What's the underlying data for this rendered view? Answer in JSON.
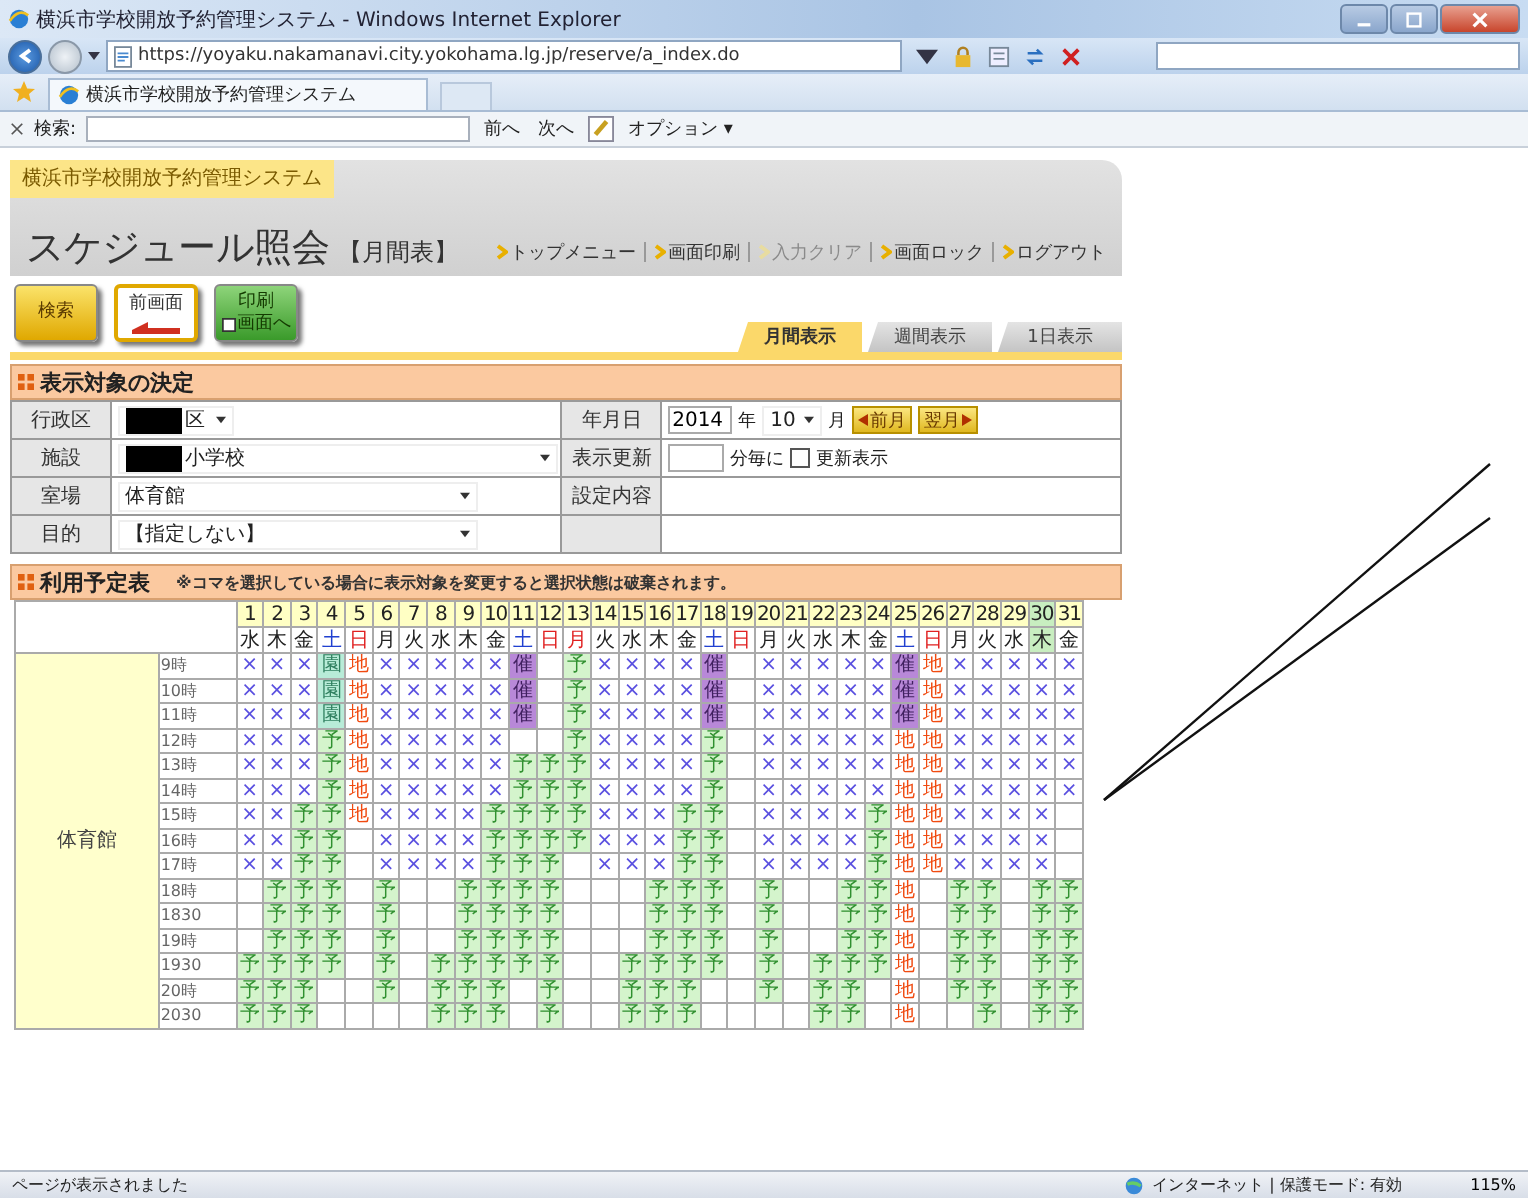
{
  "browser": {
    "title": "横浜市学校開放予約管理システム - Windows Internet Explorer",
    "url": "https://yoyaku.nakamanavi.city.yokohama.lg.jp/reserve/a_index.do",
    "tab": "横浜市学校開放予約管理システム",
    "search_label": "検索:",
    "find_prev": "前へ",
    "find_next": "次へ",
    "options": "オプション ▾"
  },
  "header": {
    "system_name": "横浜市学校開放予約管理システム",
    "page_title": "スケジュール照会",
    "page_subtitle": "【月間表】",
    "links": [
      {
        "label": "トップメニュー",
        "disabled": false
      },
      {
        "label": "画面印刷",
        "disabled": false
      },
      {
        "label": "入力クリア",
        "disabled": true
      },
      {
        "label": "画面ロック",
        "disabled": false
      },
      {
        "label": "ログアウト",
        "disabled": false
      }
    ]
  },
  "buttons": [
    {
      "kind": "search",
      "lines": [
        "検索"
      ]
    },
    {
      "kind": "back",
      "lines": [
        "前画面"
      ]
    },
    {
      "kind": "print",
      "lines": [
        "印刷",
        "画面へ"
      ]
    }
  ],
  "view_tabs": [
    {
      "label": "月間表示",
      "selected": true
    },
    {
      "label": "週間表示",
      "selected": false
    },
    {
      "label": "1日表示",
      "selected": false
    }
  ],
  "target": {
    "title": "表示対象の決定",
    "fields": [
      {
        "label": "行政区",
        "value": "区",
        "redacted": true
      },
      {
        "label": "施設",
        "value": "小学校",
        "redacted": true
      },
      {
        "label": "室場",
        "value": "体育館",
        "redacted": false
      },
      {
        "label": "目的",
        "value": "【指定しない】",
        "redacted": false
      }
    ],
    "date": {
      "label": "年月日",
      "year": "2014",
      "year_unit": "年",
      "month": "10",
      "month_unit": "月",
      "prev": "前月",
      "next": "翌月"
    },
    "refresh": {
      "label": "表示更新",
      "unit": "分毎に",
      "checkbox_label": "更新表示",
      "checked": false
    },
    "settings": {
      "label": "設定内容"
    }
  },
  "schedule": {
    "title": "利用予定表",
    "note": "※コマを選択している場合に表示対象を変更すると選択状態は破棄されます。",
    "facility": "体育館",
    "days": [
      {
        "date": "1",
        "weekday": "水",
        "kind": "weekday"
      },
      {
        "date": "2",
        "weekday": "木",
        "kind": "weekday"
      },
      {
        "date": "3",
        "weekday": "金",
        "kind": "weekday"
      },
      {
        "date": "4",
        "weekday": "土",
        "kind": "saturday"
      },
      {
        "date": "5",
        "weekday": "日",
        "kind": "holiday"
      },
      {
        "date": "6",
        "weekday": "月",
        "kind": "weekday"
      },
      {
        "date": "7",
        "weekday": "火",
        "kind": "weekday"
      },
      {
        "date": "8",
        "weekday": "水",
        "kind": "weekday"
      },
      {
        "date": "9",
        "weekday": "木",
        "kind": "weekday"
      },
      {
        "date": "10",
        "weekday": "金",
        "kind": "weekday"
      },
      {
        "date": "11",
        "weekday": "土",
        "kind": "saturday"
      },
      {
        "date": "12",
        "weekday": "日",
        "kind": "holiday"
      },
      {
        "date": "13",
        "weekday": "月",
        "kind": "holiday"
      },
      {
        "date": "14",
        "weekday": "火",
        "kind": "weekday"
      },
      {
        "date": "15",
        "weekday": "水",
        "kind": "weekday"
      },
      {
        "date": "16",
        "weekday": "木",
        "kind": "weekday"
      },
      {
        "date": "17",
        "weekday": "金",
        "kind": "weekday"
      },
      {
        "date": "18",
        "weekday": "土",
        "kind": "saturday"
      },
      {
        "date": "19",
        "weekday": "日",
        "kind": "holiday"
      },
      {
        "date": "20",
        "weekday": "月",
        "kind": "weekday"
      },
      {
        "date": "21",
        "weekday": "火",
        "kind": "weekday"
      },
      {
        "date": "22",
        "weekday": "水",
        "kind": "weekday"
      },
      {
        "date": "23",
        "weekday": "木",
        "kind": "weekday"
      },
      {
        "date": "24",
        "weekday": "金",
        "kind": "weekday"
      },
      {
        "date": "25",
        "weekday": "土",
        "kind": "saturday"
      },
      {
        "date": "26",
        "weekday": "日",
        "kind": "holiday"
      },
      {
        "date": "27",
        "weekday": "月",
        "kind": "weekday"
      },
      {
        "date": "28",
        "weekday": "火",
        "kind": "weekday"
      },
      {
        "date": "29",
        "weekday": "水",
        "kind": "weekday"
      },
      {
        "date": "30",
        "weekday": "木",
        "kind": "today"
      },
      {
        "date": "31",
        "weekday": "金",
        "kind": "weekday"
      }
    ],
    "rows": [
      {
        "time": "9時",
        "cells": [
          {
            "text": "×",
            "kind": "unavailable"
          },
          {
            "text": "×",
            "kind": "unavailable"
          },
          {
            "text": "×",
            "kind": "unavailable"
          },
          {
            "text": "園",
            "kind": "group"
          },
          {
            "text": "地",
            "kind": "local"
          },
          {
            "text": "×",
            "kind": "unavailable"
          },
          {
            "text": "×",
            "kind": "unavailable"
          },
          {
            "text": "×",
            "kind": "unavailable"
          },
          {
            "text": "×",
            "kind": "unavailable"
          },
          {
            "text": "×",
            "kind": "unavailable"
          },
          {
            "text": "催",
            "kind": "event"
          },
          null,
          {
            "text": "予",
            "kind": "reserved"
          },
          {
            "text": "×",
            "kind": "unavailable"
          },
          {
            "text": "×",
            "kind": "unavailable"
          },
          {
            "text": "×",
            "kind": "unavailable"
          },
          {
            "text": "×",
            "kind": "unavailable"
          },
          {
            "text": "催",
            "kind": "event"
          },
          null,
          {
            "text": "×",
            "kind": "unavailable"
          },
          {
            "text": "×",
            "kind": "unavailable"
          },
          {
            "text": "×",
            "kind": "unavailable"
          },
          {
            "text": "×",
            "kind": "unavailable"
          },
          {
            "text": "×",
            "kind": "unavailable"
          },
          {
            "text": "催",
            "kind": "event"
          },
          {
            "text": "地",
            "kind": "local"
          },
          {
            "text": "×",
            "kind": "unavailable"
          },
          {
            "text": "×",
            "kind": "unavailable"
          },
          {
            "text": "×",
            "kind": "unavailable"
          },
          {
            "text": "×",
            "kind": "unavailable"
          },
          {
            "text": "×",
            "kind": "unavailable"
          }
        ]
      },
      {
        "time": "10時",
        "cells": [
          {
            "text": "×",
            "kind": "unavailable"
          },
          {
            "text": "×",
            "kind": "unavailable"
          },
          {
            "text": "×",
            "kind": "unavailable"
          },
          {
            "text": "園",
            "kind": "group"
          },
          {
            "text": "地",
            "kind": "local"
          },
          {
            "text": "×",
            "kind": "unavailable"
          },
          {
            "text": "×",
            "kind": "unavailable"
          },
          {
            "text": "×",
            "kind": "unavailable"
          },
          {
            "text": "×",
            "kind": "unavailable"
          },
          {
            "text": "×",
            "kind": "unavailable"
          },
          {
            "text": "催",
            "kind": "event"
          },
          null,
          {
            "text": "予",
            "kind": "reserved"
          },
          {
            "text": "×",
            "kind": "unavailable"
          },
          {
            "text": "×",
            "kind": "unavailable"
          },
          {
            "text": "×",
            "kind": "unavailable"
          },
          {
            "text": "×",
            "kind": "unavailable"
          },
          {
            "text": "催",
            "kind": "event"
          },
          null,
          {
            "text": "×",
            "kind": "unavailable"
          },
          {
            "text": "×",
            "kind": "unavailable"
          },
          {
            "text": "×",
            "kind": "unavailable"
          },
          {
            "text": "×",
            "kind": "unavailable"
          },
          {
            "text": "×",
            "kind": "unavailable"
          },
          {
            "text": "催",
            "kind": "event"
          },
          {
            "text": "地",
            "kind": "local"
          },
          {
            "text": "×",
            "kind": "unavailable"
          },
          {
            "text": "×",
            "kind": "unavailable"
          },
          {
            "text": "×",
            "kind": "unavailable"
          },
          {
            "text": "×",
            "kind": "unavailable"
          },
          {
            "text": "×",
            "kind": "unavailable"
          }
        ]
      },
      {
        "time": "11時",
        "cells": [
          {
            "text": "×",
            "kind": "unavailable"
          },
          {
            "text": "×",
            "kind": "unavailable"
          },
          {
            "text": "×",
            "kind": "unavailable"
          },
          {
            "text": "園",
            "kind": "group"
          },
          {
            "text": "地",
            "kind": "local"
          },
          {
            "text": "×",
            "kind": "unavailable"
          },
          {
            "text": "×",
            "kind": "unavailable"
          },
          {
            "text": "×",
            "kind": "unavailable"
          },
          {
            "text": "×",
            "kind": "unavailable"
          },
          {
            "text": "×",
            "kind": "unavailable"
          },
          {
            "text": "催",
            "kind": "event"
          },
          null,
          {
            "text": "予",
            "kind": "reserved"
          },
          {
            "text": "×",
            "kind": "unavailable"
          },
          {
            "text": "×",
            "kind": "unavailable"
          },
          {
            "text": "×",
            "kind": "unavailable"
          },
          {
            "text": "×",
            "kind": "unavailable"
          },
          {
            "text": "催",
            "kind": "event"
          },
          null,
          {
            "text": "×",
            "kind": "unavailable"
          },
          {
            "text": "×",
            "kind": "unavailable"
          },
          {
            "text": "×",
            "kind": "unavailable"
          },
          {
            "text": "×",
            "kind": "unavailable"
          },
          {
            "text": "×",
            "kind": "unavailable"
          },
          {
            "text": "催",
            "kind": "event"
          },
          {
            "text": "地",
            "kind": "local"
          },
          {
            "text": "×",
            "kind": "unavailable"
          },
          {
            "text": "×",
            "kind": "unavailable"
          },
          {
            "text": "×",
            "kind": "unavailable"
          },
          {
            "text": "×",
            "kind": "unavailable"
          },
          {
            "text": "×",
            "kind": "unavailable"
          }
        ]
      },
      {
        "time": "12時",
        "cells": [
          {
            "text": "×",
            "kind": "unavailable"
          },
          {
            "text": "×",
            "kind": "unavailable"
          },
          {
            "text": "×",
            "kind": "unavailable"
          },
          {
            "text": "予",
            "kind": "reserved"
          },
          {
            "text": "地",
            "kind": "local"
          },
          {
            "text": "×",
            "kind": "unavailable"
          },
          {
            "text": "×",
            "kind": "unavailable"
          },
          {
            "text": "×",
            "kind": "unavailable"
          },
          {
            "text": "×",
            "kind": "unavailable"
          },
          {
            "text": "×",
            "kind": "unavailable"
          },
          null,
          null,
          {
            "text": "予",
            "kind": "reserved"
          },
          {
            "text": "×",
            "kind": "unavailable"
          },
          {
            "text": "×",
            "kind": "unavailable"
          },
          {
            "text": "×",
            "kind": "unavailable"
          },
          {
            "text": "×",
            "kind": "unavailable"
          },
          {
            "text": "予",
            "kind": "reserved"
          },
          null,
          {
            "text": "×",
            "kind": "unavailable"
          },
          {
            "text": "×",
            "kind": "unavailable"
          },
          {
            "text": "×",
            "kind": "unavailable"
          },
          {
            "text": "×",
            "kind": "unavailable"
          },
          {
            "text": "×",
            "kind": "unavailable"
          },
          {
            "text": "地",
            "kind": "local"
          },
          {
            "text": "地",
            "kind": "local"
          },
          {
            "text": "×",
            "kind": "unavailable"
          },
          {
            "text": "×",
            "kind": "unavailable"
          },
          {
            "text": "×",
            "kind": "unavailable"
          },
          {
            "text": "×",
            "kind": "unavailable"
          },
          {
            "text": "×",
            "kind": "unavailable"
          }
        ]
      },
      {
        "time": "13時",
        "cells": [
          {
            "text": "×",
            "kind": "unavailable"
          },
          {
            "text": "×",
            "kind": "unavailable"
          },
          {
            "text": "×",
            "kind": "unavailable"
          },
          {
            "text": "予",
            "kind": "reserved"
          },
          {
            "text": "地",
            "kind": "local"
          },
          {
            "text": "×",
            "kind": "unavailable"
          },
          {
            "text": "×",
            "kind": "unavailable"
          },
          {
            "text": "×",
            "kind": "unavailable"
          },
          {
            "text": "×",
            "kind": "unavailable"
          },
          {
            "text": "×",
            "kind": "unavailable"
          },
          {
            "text": "予",
            "kind": "reserved"
          },
          {
            "text": "予",
            "kind": "reserved"
          },
          {
            "text": "予",
            "kind": "reserved"
          },
          {
            "text": "×",
            "kind": "unavailable"
          },
          {
            "text": "×",
            "kind": "unavailable"
          },
          {
            "text": "×",
            "kind": "unavailable"
          },
          {
            "text": "×",
            "kind": "unavailable"
          },
          {
            "text": "予",
            "kind": "reserved"
          },
          null,
          {
            "text": "×",
            "kind": "unavailable"
          },
          {
            "text": "×",
            "kind": "unavailable"
          },
          {
            "text": "×",
            "kind": "unavailable"
          },
          {
            "text": "×",
            "kind": "unavailable"
          },
          {
            "text": "×",
            "kind": "unavailable"
          },
          {
            "text": "地",
            "kind": "local"
          },
          {
            "text": "地",
            "kind": "local"
          },
          {
            "text": "×",
            "kind": "unavailable"
          },
          {
            "text": "×",
            "kind": "unavailable"
          },
          {
            "text": "×",
            "kind": "unavailable"
          },
          {
            "text": "×",
            "kind": "unavailable"
          },
          {
            "text": "×",
            "kind": "unavailable"
          }
        ]
      },
      {
        "time": "14時",
        "cells": [
          {
            "text": "×",
            "kind": "unavailable"
          },
          {
            "text": "×",
            "kind": "unavailable"
          },
          {
            "text": "×",
            "kind": "unavailable"
          },
          {
            "text": "予",
            "kind": "reserved"
          },
          {
            "text": "地",
            "kind": "local"
          },
          {
            "text": "×",
            "kind": "unavailable"
          },
          {
            "text": "×",
            "kind": "unavailable"
          },
          {
            "text": "×",
            "kind": "unavailable"
          },
          {
            "text": "×",
            "kind": "unavailable"
          },
          {
            "text": "×",
            "kind": "unavailable"
          },
          {
            "text": "予",
            "kind": "reserved"
          },
          {
            "text": "予",
            "kind": "reserved"
          },
          {
            "text": "予",
            "kind": "reserved"
          },
          {
            "text": "×",
            "kind": "unavailable"
          },
          {
            "text": "×",
            "kind": "unavailable"
          },
          {
            "text": "×",
            "kind": "unavailable"
          },
          {
            "text": "×",
            "kind": "unavailable"
          },
          {
            "text": "予",
            "kind": "reserved"
          },
          null,
          {
            "text": "×",
            "kind": "unavailable"
          },
          {
            "text": "×",
            "kind": "unavailable"
          },
          {
            "text": "×",
            "kind": "unavailable"
          },
          {
            "text": "×",
            "kind": "unavailable"
          },
          {
            "text": "×",
            "kind": "unavailable"
          },
          {
            "text": "地",
            "kind": "local"
          },
          {
            "text": "地",
            "kind": "local"
          },
          {
            "text": "×",
            "kind": "unavailable"
          },
          {
            "text": "×",
            "kind": "unavailable"
          },
          {
            "text": "×",
            "kind": "unavailable"
          },
          {
            "text": "×",
            "kind": "unavailable"
          },
          {
            "text": "×",
            "kind": "unavailable"
          }
        ]
      },
      {
        "time": "15時",
        "cells": [
          {
            "text": "×",
            "kind": "unavailable"
          },
          {
            "text": "×",
            "kind": "unavailable"
          },
          {
            "text": "予",
            "kind": "reserved"
          },
          {
            "text": "予",
            "kind": "reserved"
          },
          {
            "text": "地",
            "kind": "local"
          },
          {
            "text": "×",
            "kind": "unavailable"
          },
          {
            "text": "×",
            "kind": "unavailable"
          },
          {
            "text": "×",
            "kind": "unavailable"
          },
          {
            "text": "×",
            "kind": "unavailable"
          },
          {
            "text": "予",
            "kind": "reserved"
          },
          {
            "text": "予",
            "kind": "reserved"
          },
          {
            "text": "予",
            "kind": "reserved"
          },
          {
            "text": "予",
            "kind": "reserved"
          },
          {
            "text": "×",
            "kind": "unavailable"
          },
          {
            "text": "×",
            "kind": "unavailable"
          },
          {
            "text": "×",
            "kind": "unavailable"
          },
          {
            "text": "予",
            "kind": "reserved"
          },
          {
            "text": "予",
            "kind": "reserved"
          },
          null,
          {
            "text": "×",
            "kind": "unavailable"
          },
          {
            "text": "×",
            "kind": "unavailable"
          },
          {
            "text": "×",
            "kind": "unavailable"
          },
          {
            "text": "×",
            "kind": "unavailable"
          },
          {
            "text": "予",
            "kind": "reserved"
          },
          {
            "text": "地",
            "kind": "local"
          },
          {
            "text": "地",
            "kind": "local"
          },
          {
            "text": "×",
            "kind": "unavailable"
          },
          {
            "text": "×",
            "kind": "unavailable"
          },
          {
            "text": "×",
            "kind": "unavailable"
          },
          {
            "text": "×",
            "kind": "unavailable"
          },
          null
        ]
      },
      {
        "time": "16時",
        "cells": [
          {
            "text": "×",
            "kind": "unavailable"
          },
          {
            "text": "×",
            "kind": "unavailable"
          },
          {
            "text": "予",
            "kind": "reserved"
          },
          {
            "text": "予",
            "kind": "reserved"
          },
          null,
          {
            "text": "×",
            "kind": "unavailable"
          },
          {
            "text": "×",
            "kind": "unavailable"
          },
          {
            "text": "×",
            "kind": "unavailable"
          },
          {
            "text": "×",
            "kind": "unavailable"
          },
          {
            "text": "予",
            "kind": "reserved"
          },
          {
            "text": "予",
            "kind": "reserved"
          },
          {
            "text": "予",
            "kind": "reserved"
          },
          {
            "text": "予",
            "kind": "reserved"
          },
          {
            "text": "×",
            "kind": "unavailable"
          },
          {
            "text": "×",
            "kind": "unavailable"
          },
          {
            "text": "×",
            "kind": "unavailable"
          },
          {
            "text": "予",
            "kind": "reserved"
          },
          {
            "text": "予",
            "kind": "reserved"
          },
          null,
          {
            "text": "×",
            "kind": "unavailable"
          },
          {
            "text": "×",
            "kind": "unavailable"
          },
          {
            "text": "×",
            "kind": "unavailable"
          },
          {
            "text": "×",
            "kind": "unavailable"
          },
          {
            "text": "予",
            "kind": "reserved"
          },
          {
            "text": "地",
            "kind": "local"
          },
          {
            "text": "地",
            "kind": "local"
          },
          {
            "text": "×",
            "kind": "unavailable"
          },
          {
            "text": "×",
            "kind": "unavailable"
          },
          {
            "text": "×",
            "kind": "unavailable"
          },
          {
            "text": "×",
            "kind": "unavailable"
          },
          null
        ]
      },
      {
        "time": "17時",
        "cells": [
          {
            "text": "×",
            "kind": "unavailable"
          },
          {
            "text": "×",
            "kind": "unavailable"
          },
          {
            "text": "予",
            "kind": "reserved"
          },
          {
            "text": "予",
            "kind": "reserved"
          },
          null,
          {
            "text": "×",
            "kind": "unavailable"
          },
          {
            "text": "×",
            "kind": "unavailable"
          },
          {
            "text": "×",
            "kind": "unavailable"
          },
          {
            "text": "×",
            "kind": "unavailable"
          },
          {
            "text": "予",
            "kind": "reserved"
          },
          {
            "text": "予",
            "kind": "reserved"
          },
          {
            "text": "予",
            "kind": "reserved"
          },
          null,
          {
            "text": "×",
            "kind": "unavailable"
          },
          {
            "text": "×",
            "kind": "unavailable"
          },
          {
            "text": "×",
            "kind": "unavailable"
          },
          {
            "text": "予",
            "kind": "reserved"
          },
          {
            "text": "予",
            "kind": "reserved"
          },
          null,
          {
            "text": "×",
            "kind": "unavailable"
          },
          {
            "text": "×",
            "kind": "unavailable"
          },
          {
            "text": "×",
            "kind": "unavailable"
          },
          {
            "text": "×",
            "kind": "unavailable"
          },
          {
            "text": "予",
            "kind": "reserved"
          },
          {
            "text": "地",
            "kind": "local"
          },
          {
            "text": "地",
            "kind": "local"
          },
          {
            "text": "×",
            "kind": "unavailable"
          },
          {
            "text": "×",
            "kind": "unavailable"
          },
          {
            "text": "×",
            "kind": "unavailable"
          },
          {
            "text": "×",
            "kind": "unavailable"
          },
          null
        ]
      },
      {
        "time": "18時",
        "cells": [
          null,
          {
            "text": "予",
            "kind": "reserved"
          },
          {
            "text": "予",
            "kind": "reserved"
          },
          {
            "text": "予",
            "kind": "reserved"
          },
          null,
          {
            "text": "予",
            "kind": "reserved"
          },
          null,
          null,
          {
            "text": "予",
            "kind": "reserved"
          },
          {
            "text": "予",
            "kind": "reserved"
          },
          {
            "text": "予",
            "kind": "reserved"
          },
          {
            "text": "予",
            "kind": "reserved"
          },
          null,
          null,
          null,
          {
            "text": "予",
            "kind": "reserved"
          },
          {
            "text": "予",
            "kind": "reserved"
          },
          {
            "text": "予",
            "kind": "reserved"
          },
          null,
          {
            "text": "予",
            "kind": "reserved"
          },
          null,
          null,
          {
            "text": "予",
            "kind": "reserved"
          },
          {
            "text": "予",
            "kind": "reserved"
          },
          {
            "text": "地",
            "kind": "local"
          },
          null,
          {
            "text": "予",
            "kind": "reserved"
          },
          {
            "text": "予",
            "kind": "reserved"
          },
          null,
          {
            "text": "予",
            "kind": "reserved"
          },
          {
            "text": "予",
            "kind": "reserved"
          }
        ]
      },
      {
        "time": "1830",
        "cells": [
          null,
          {
            "text": "予",
            "kind": "reserved"
          },
          {
            "text": "予",
            "kind": "reserved"
          },
          {
            "text": "予",
            "kind": "reserved"
          },
          null,
          {
            "text": "予",
            "kind": "reserved"
          },
          null,
          null,
          {
            "text": "予",
            "kind": "reserved"
          },
          {
            "text": "予",
            "kind": "reserved"
          },
          {
            "text": "予",
            "kind": "reserved"
          },
          {
            "text": "予",
            "kind": "reserved"
          },
          null,
          null,
          null,
          {
            "text": "予",
            "kind": "reserved"
          },
          {
            "text": "予",
            "kind": "reserved"
          },
          {
            "text": "予",
            "kind": "reserved"
          },
          null,
          {
            "text": "予",
            "kind": "reserved"
          },
          null,
          null,
          {
            "text": "予",
            "kind": "reserved"
          },
          {
            "text": "予",
            "kind": "reserved"
          },
          {
            "text": "地",
            "kind": "local"
          },
          null,
          {
            "text": "予",
            "kind": "reserved"
          },
          {
            "text": "予",
            "kind": "reserved"
          },
          null,
          {
            "text": "予",
            "kind": "reserved"
          },
          {
            "text": "予",
            "kind": "reserved"
          }
        ]
      },
      {
        "time": "19時",
        "cells": [
          null,
          {
            "text": "予",
            "kind": "reserved"
          },
          {
            "text": "予",
            "kind": "reserved"
          },
          {
            "text": "予",
            "kind": "reserved"
          },
          null,
          {
            "text": "予",
            "kind": "reserved"
          },
          null,
          null,
          {
            "text": "予",
            "kind": "reserved"
          },
          {
            "text": "予",
            "kind": "reserved"
          },
          {
            "text": "予",
            "kind": "reserved"
          },
          {
            "text": "予",
            "kind": "reserved"
          },
          null,
          null,
          null,
          {
            "text": "予",
            "kind": "reserved"
          },
          {
            "text": "予",
            "kind": "reserved"
          },
          {
            "text": "予",
            "kind": "reserved"
          },
          null,
          {
            "text": "予",
            "kind": "reserved"
          },
          null,
          null,
          {
            "text": "予",
            "kind": "reserved"
          },
          {
            "text": "予",
            "kind": "reserved"
          },
          {
            "text": "地",
            "kind": "local"
          },
          null,
          {
            "text": "予",
            "kind": "reserved"
          },
          {
            "text": "予",
            "kind": "reserved"
          },
          null,
          {
            "text": "予",
            "kind": "reserved"
          },
          {
            "text": "予",
            "kind": "reserved"
          }
        ]
      },
      {
        "time": "1930",
        "cells": [
          {
            "text": "予",
            "kind": "reserved"
          },
          {
            "text": "予",
            "kind": "reserved"
          },
          {
            "text": "予",
            "kind": "reserved"
          },
          {
            "text": "予",
            "kind": "reserved"
          },
          null,
          {
            "text": "予",
            "kind": "reserved"
          },
          null,
          {
            "text": "予",
            "kind": "reserved"
          },
          {
            "text": "予",
            "kind": "reserved"
          },
          {
            "text": "予",
            "kind": "reserved"
          },
          {
            "text": "予",
            "kind": "reserved"
          },
          {
            "text": "予",
            "kind": "reserved"
          },
          null,
          null,
          {
            "text": "予",
            "kind": "reserved"
          },
          {
            "text": "予",
            "kind": "reserved"
          },
          {
            "text": "予",
            "kind": "reserved"
          },
          {
            "text": "予",
            "kind": "reserved"
          },
          null,
          {
            "text": "予",
            "kind": "reserved"
          },
          null,
          {
            "text": "予",
            "kind": "reserved"
          },
          {
            "text": "予",
            "kind": "reserved"
          },
          {
            "text": "予",
            "kind": "reserved"
          },
          {
            "text": "地",
            "kind": "local"
          },
          null,
          {
            "text": "予",
            "kind": "reserved"
          },
          {
            "text": "予",
            "kind": "reserved"
          },
          null,
          {
            "text": "予",
            "kind": "reserved"
          },
          {
            "text": "予",
            "kind": "reserved"
          }
        ]
      },
      {
        "time": "20時",
        "cells": [
          {
            "text": "予",
            "kind": "reserved"
          },
          {
            "text": "予",
            "kind": "reserved"
          },
          {
            "text": "予",
            "kind": "reserved"
          },
          null,
          null,
          {
            "text": "予",
            "kind": "reserved"
          },
          null,
          {
            "text": "予",
            "kind": "reserved"
          },
          {
            "text": "予",
            "kind": "reserved"
          },
          {
            "text": "予",
            "kind": "reserved"
          },
          null,
          {
            "text": "予",
            "kind": "reserved"
          },
          null,
          null,
          {
            "text": "予",
            "kind": "reserved"
          },
          {
            "text": "予",
            "kind": "reserved"
          },
          {
            "text": "予",
            "kind": "reserved"
          },
          null,
          null,
          {
            "text": "予",
            "kind": "reserved"
          },
          null,
          {
            "text": "予",
            "kind": "reserved"
          },
          {
            "text": "予",
            "kind": "reserved"
          },
          null,
          {
            "text": "地",
            "kind": "local"
          },
          null,
          {
            "text": "予",
            "kind": "reserved"
          },
          {
            "text": "予",
            "kind": "reserved"
          },
          null,
          {
            "text": "予",
            "kind": "reserved"
          },
          {
            "text": "予",
            "kind": "reserved"
          }
        ]
      },
      {
        "time": "2030",
        "cells": [
          {
            "text": "予",
            "kind": "reserved"
          },
          {
            "text": "予",
            "kind": "reserved"
          },
          {
            "text": "予",
            "kind": "reserved"
          },
          null,
          null,
          null,
          null,
          {
            "text": "予",
            "kind": "reserved"
          },
          {
            "text": "予",
            "kind": "reserved"
          },
          {
            "text": "予",
            "kind": "reserved"
          },
          null,
          {
            "text": "予",
            "kind": "reserved"
          },
          null,
          null,
          {
            "text": "予",
            "kind": "reserved"
          },
          {
            "text": "予",
            "kind": "reserved"
          },
          {
            "text": "予",
            "kind": "reserved"
          },
          null,
          null,
          null,
          null,
          {
            "text": "予",
            "kind": "reserved"
          },
          {
            "text": "予",
            "kind": "reserved"
          },
          null,
          {
            "text": "地",
            "kind": "local"
          },
          null,
          null,
          {
            "text": "予",
            "kind": "reserved"
          },
          null,
          {
            "text": "予",
            "kind": "reserved"
          },
          {
            "text": "予",
            "kind": "reserved"
          }
        ]
      }
    ]
  },
  "status_bar": {
    "message": "ページが表示されました",
    "zone": "インターネット | 保護モード: 有効",
    "zoom": "115%"
  }
}
